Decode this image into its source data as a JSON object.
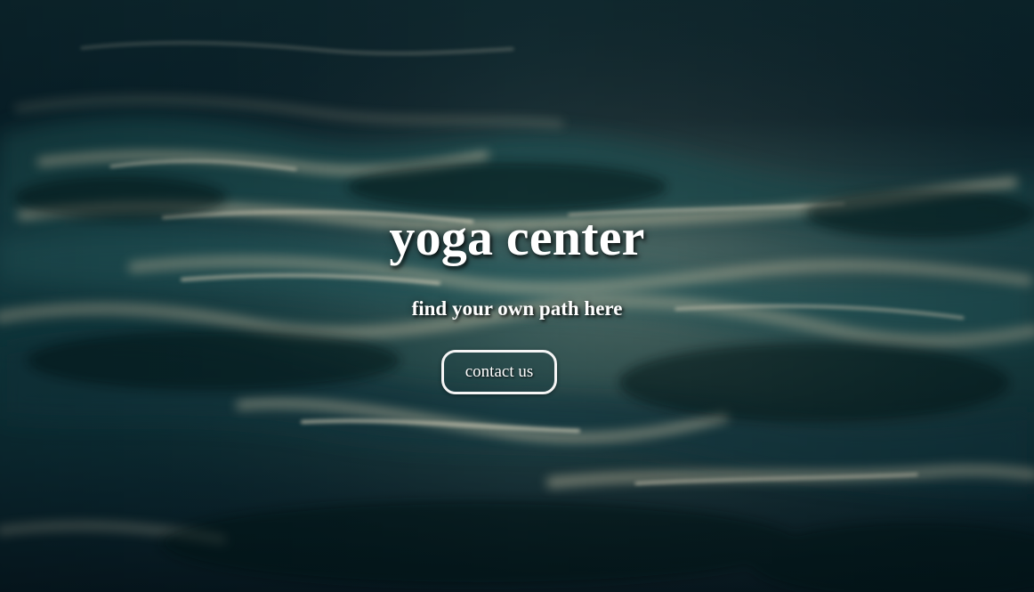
{
  "hero": {
    "title": "yoga center",
    "subtitle": "find your own path here",
    "contact_button_label": "contact us",
    "background_image": "dark teal water surface with light reflections"
  },
  "colors": {
    "text": "#ffffff",
    "water_dark": "#061c27",
    "water_teal": "#235f61",
    "highlight": "#f1ead0"
  }
}
